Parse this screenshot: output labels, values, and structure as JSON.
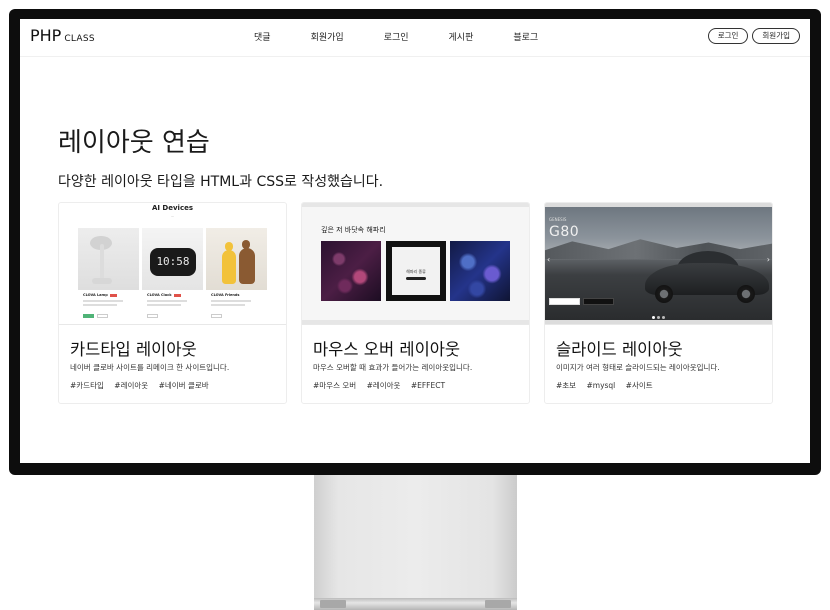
{
  "header": {
    "logo": "PHP",
    "logo_sub": "CLASS",
    "nav": [
      "댓글",
      "회원가입",
      "로그인",
      "게시판",
      "블로그"
    ],
    "login_button": "로그인",
    "signup_button": "회원가입"
  },
  "main": {
    "title": "레이아웃 연습",
    "description": "다양한 레이아웃 타입을 HTML과 CSS로 작성했습니다."
  },
  "cards": [
    {
      "title": "카드타입 레이아웃",
      "description": "네이버 클로바 사이트를 리메이크 한 사이트입니다.",
      "tags": [
        "#카드타입",
        "#레이아웃",
        "#네이버 클로바"
      ],
      "thumb": {
        "heading": "AI Devices",
        "products": [
          "CLOVA Lamp",
          "CLOVA Clock",
          "CLOVA Friends"
        ],
        "clock_display": "10:58"
      }
    },
    {
      "title": "마우스 오버 레이아웃",
      "description": "마우스 오버할 때 효과가 들어가는 레이아웃입니다.",
      "tags": [
        "#마우스 오버",
        "#레이아웃",
        "#EFFECT"
      ],
      "thumb": {
        "heading": "깊은 저 바닷속 해파리",
        "center_text": "해파리 종류"
      }
    },
    {
      "title": "슬라이드 레이아웃",
      "description": "이미지가 여러 형태로 슬라이드되는 레이아웃입니다.",
      "tags": [
        "#초보",
        "#mysql",
        "#사이트"
      ],
      "thumb": {
        "brand": "GENESIS",
        "model": "G80",
        "left_arrow": "‹",
        "right_arrow": "›"
      }
    }
  ]
}
